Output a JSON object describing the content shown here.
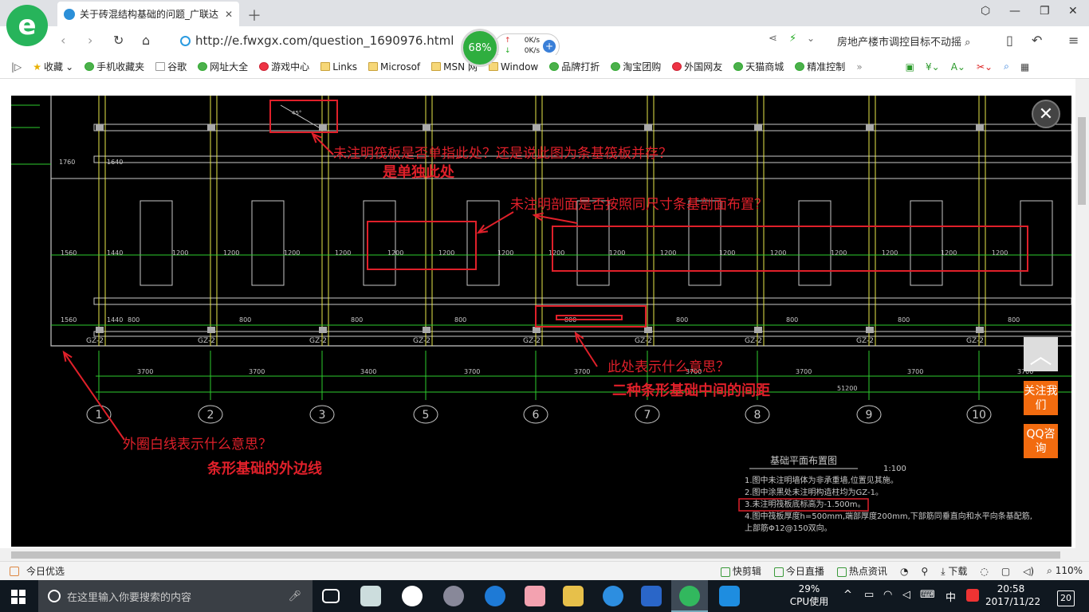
{
  "browser": {
    "tab_title": "关于砖混结构基础的问题_广联达",
    "url": "http://e.fwxgx.com/question_1690976.html",
    "speed_percent": "68%",
    "net_up": "0K/s",
    "net_down": "0K/s",
    "search_text": "房地产楼市调控目标不动摇",
    "bookmarks": [
      "收藏",
      "手机收藏夹",
      "谷歌",
      "网址大全",
      "游戏中心",
      "Links",
      "Microsof",
      "MSN 网",
      "Window",
      "品牌打折",
      "淘宝团购",
      "外国网友",
      "天猫商城",
      "精准控制"
    ]
  },
  "drawing": {
    "dims_left": [
      "1760",
      "1640",
      "1560",
      "1440",
      "1560",
      "1440"
    ],
    "dim_pairs": [
      "1200",
      "1200"
    ],
    "dim_800": "800",
    "gz_label": "GZ-2",
    "spans": [
      "3700",
      "3700",
      "3400",
      "3700",
      "3700",
      "3700",
      "3700",
      "3700",
      "3700"
    ],
    "total": "51200",
    "axes": [
      "1",
      "2",
      "3",
      "5",
      "6",
      "7",
      "8",
      "9",
      "10"
    ],
    "angle_text": "45°",
    "legend_title": "基础平面布置图",
    "scale": "1:100",
    "notes": [
      "1.图中未注明墙体为非承重墙,位置见其施。",
      "2.图中涂黑处未注明构造柱均为GZ-1。",
      "3.未注明筏板底标高为-1.500m。",
      "4.图中筏板厚度h=500mm,端部厚度200mm,下部筋同垂直向和水平向条基配筋,",
      "  上部筋Φ12@150双向。"
    ]
  },
  "annotations": {
    "q1": "未注明筏板是否单指此处？还是说此图为条基筏板并存？",
    "a1": "是单独此处",
    "q2": "未注明剖面是否按照同尺寸条基剖面布置？",
    "q3": "此处表示什么意思？",
    "a3": "二种条形基础中间的间距",
    "q4": "外圈白线表示什么意思？",
    "a4": "条形基础的外边线"
  },
  "side_buttons": {
    "follow": "关注我们",
    "qq": "QQ咨询"
  },
  "statusbar": {
    "left": "今日优选",
    "items": [
      "快剪辑",
      "今日直播",
      "热点资讯",
      "下载",
      "110%"
    ]
  },
  "taskbar": {
    "search_placeholder": "在这里输入你要搜索的内容",
    "cpu_value": "29%",
    "cpu_label": "CPU使用",
    "ime": "中",
    "time": "20:58",
    "date": "2017/11/22",
    "notifications": "20"
  },
  "colors": {
    "cad_bg": "#000000",
    "cad_line": "#c8c8c8",
    "cad_green": "#2ecc2e",
    "cad_yellow": "#e8e84a",
    "annotation_red": "#e0202a",
    "accent_orange": "#f26b0f"
  }
}
